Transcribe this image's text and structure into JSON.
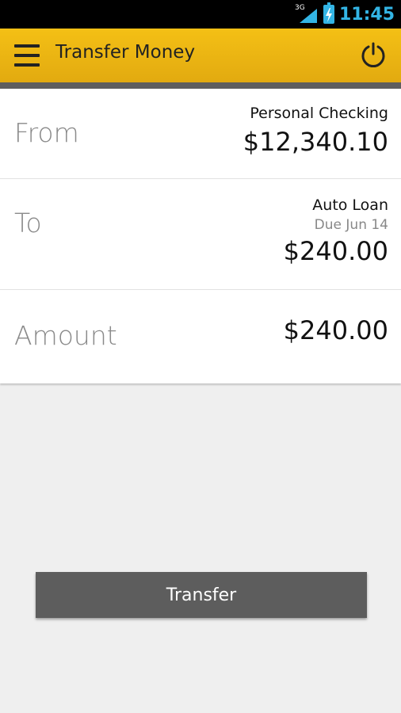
{
  "status_bar": {
    "network": "3G",
    "time": "11:45"
  },
  "app_bar": {
    "title": "Transfer Money"
  },
  "rows": {
    "from": {
      "label": "From",
      "account": "Personal Checking",
      "balance": "$12,340.10"
    },
    "to": {
      "label": "To",
      "account": "Auto Loan",
      "due": "Due Jun 14",
      "amount": "$240.00"
    },
    "amount": {
      "label": "Amount",
      "value": "$240.00"
    }
  },
  "actions": {
    "transfer_label": "Transfer"
  },
  "colors": {
    "accent": "#f4c015",
    "status_blue": "#33b5e5",
    "button": "#5d5d5d"
  },
  "icons": {
    "menu": "hamburger-icon",
    "power": "power-icon",
    "signal": "signal-icon",
    "battery": "battery-icon"
  }
}
